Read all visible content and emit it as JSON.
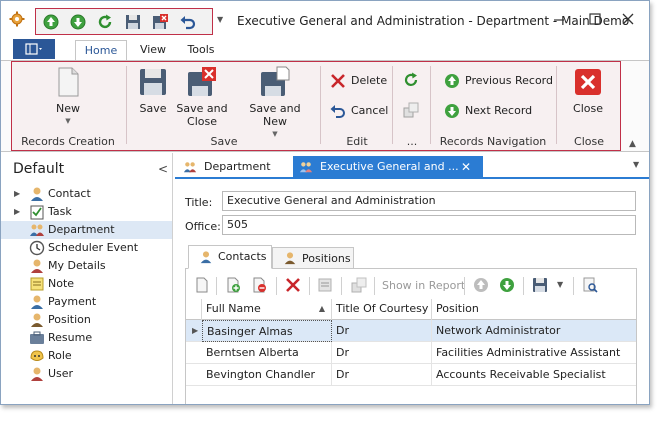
{
  "window": {
    "title": "Executive General and Administration - Department - Main Demo"
  },
  "ribbon_tabs": [
    "Home",
    "View",
    "Tools"
  ],
  "ribbon": {
    "records_creation": {
      "label": "Records Creation",
      "new": "New"
    },
    "save": {
      "label": "Save",
      "save": "Save",
      "save_close": "Save and Close",
      "save_new": "Save and New"
    },
    "edit": {
      "label": "Edit",
      "delete": "Delete",
      "cancel": "Cancel"
    },
    "more": {
      "label": "..."
    },
    "records_navigation": {
      "label": "Records Navigation",
      "previous": "Previous Record",
      "next": "Next Record"
    },
    "close": {
      "label": "Close",
      "close": "Close"
    }
  },
  "nav": {
    "title": "Default",
    "items": [
      {
        "label": "Contact",
        "expandable": true,
        "icon": "contact-icon"
      },
      {
        "label": "Task",
        "expandable": true,
        "icon": "task-icon"
      },
      {
        "label": "Department",
        "expandable": false,
        "icon": "department-icon",
        "selected": true
      },
      {
        "label": "Scheduler Event",
        "expandable": false,
        "icon": "clock-icon"
      },
      {
        "label": "My Details",
        "expandable": false,
        "icon": "person-icon"
      },
      {
        "label": "Note",
        "expandable": false,
        "icon": "note-icon"
      },
      {
        "label": "Payment",
        "expandable": false,
        "icon": "payment-icon"
      },
      {
        "label": "Position",
        "expandable": false,
        "icon": "position-icon"
      },
      {
        "label": "Resume",
        "expandable": false,
        "icon": "resume-icon"
      },
      {
        "label": "Role",
        "expandable": false,
        "icon": "role-icon"
      },
      {
        "label": "User",
        "expandable": false,
        "icon": "user-icon"
      }
    ]
  },
  "doc_tabs": [
    "Department",
    "Executive General and ..."
  ],
  "form": {
    "title_label": "Title:",
    "title_value": "Executive General and Administration",
    "office_label": "Office:",
    "office_value": "505"
  },
  "detail_tabs": [
    "Contacts",
    "Positions"
  ],
  "grid_toolbar": {
    "show_in_report": "Show in Report"
  },
  "grid": {
    "columns": [
      "Full Name",
      "Title Of Courtesy",
      "Position"
    ],
    "rows": [
      [
        "Basinger Almas",
        "Dr",
        "Network Administrator"
      ],
      [
        "Berntsen Alberta",
        "Dr",
        "Facilities Administrative Assistant"
      ],
      [
        "Bevington Chandler",
        "Dr",
        "Accounts Receivable Specialist"
      ]
    ]
  },
  "colors": {
    "accent": "#2b7cd3",
    "highlight_border": "#c03048",
    "selection": "#dbe8f7"
  }
}
